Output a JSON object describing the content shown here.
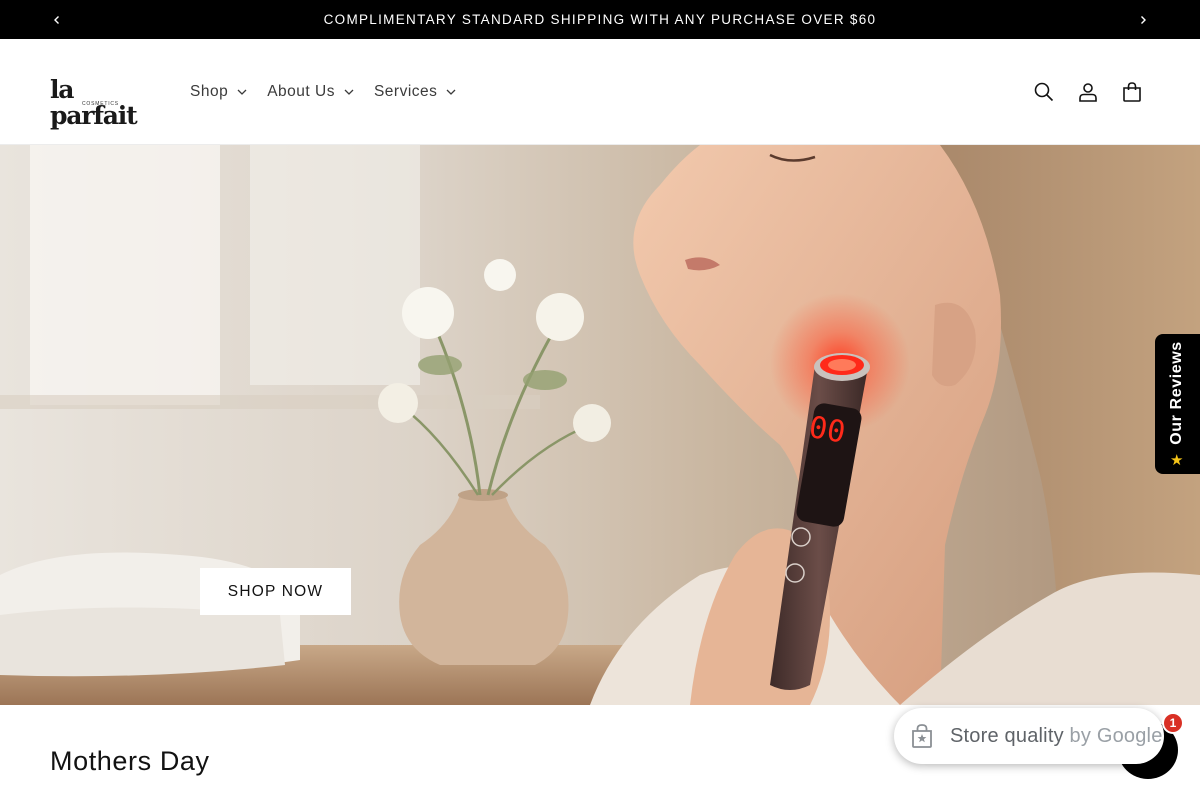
{
  "announcement": {
    "text": "COMPLIMENTARY STANDARD SHIPPING WITH ANY PURCHASE OVER $60",
    "prev_icon": "chevron-left-icon",
    "next_icon": "chevron-right-icon"
  },
  "header": {
    "logo": {
      "main": "la parfait",
      "sub": "COSMETICS"
    },
    "nav": [
      {
        "label": "Shop"
      },
      {
        "label": "About Us"
      },
      {
        "label": "Services"
      }
    ],
    "icons": [
      "search-icon",
      "account-icon",
      "cart-icon"
    ]
  },
  "hero": {
    "button_label": "SHOP NOW",
    "device_display": "00"
  },
  "reviews_tab": {
    "label": "Our Reviews",
    "icon": "star-icon"
  },
  "section": {
    "title": "Mothers Day"
  },
  "store_badge": {
    "label": "Store quality",
    "by": "by Google",
    "notification_count": "1"
  },
  "colors": {
    "announcement_bg": "#000000",
    "header_bg": "#ffffff",
    "button_bg": "#ffffff",
    "device_light": "#ff2a1a",
    "badge_notification": "#d93025",
    "star": "#f5c518"
  }
}
